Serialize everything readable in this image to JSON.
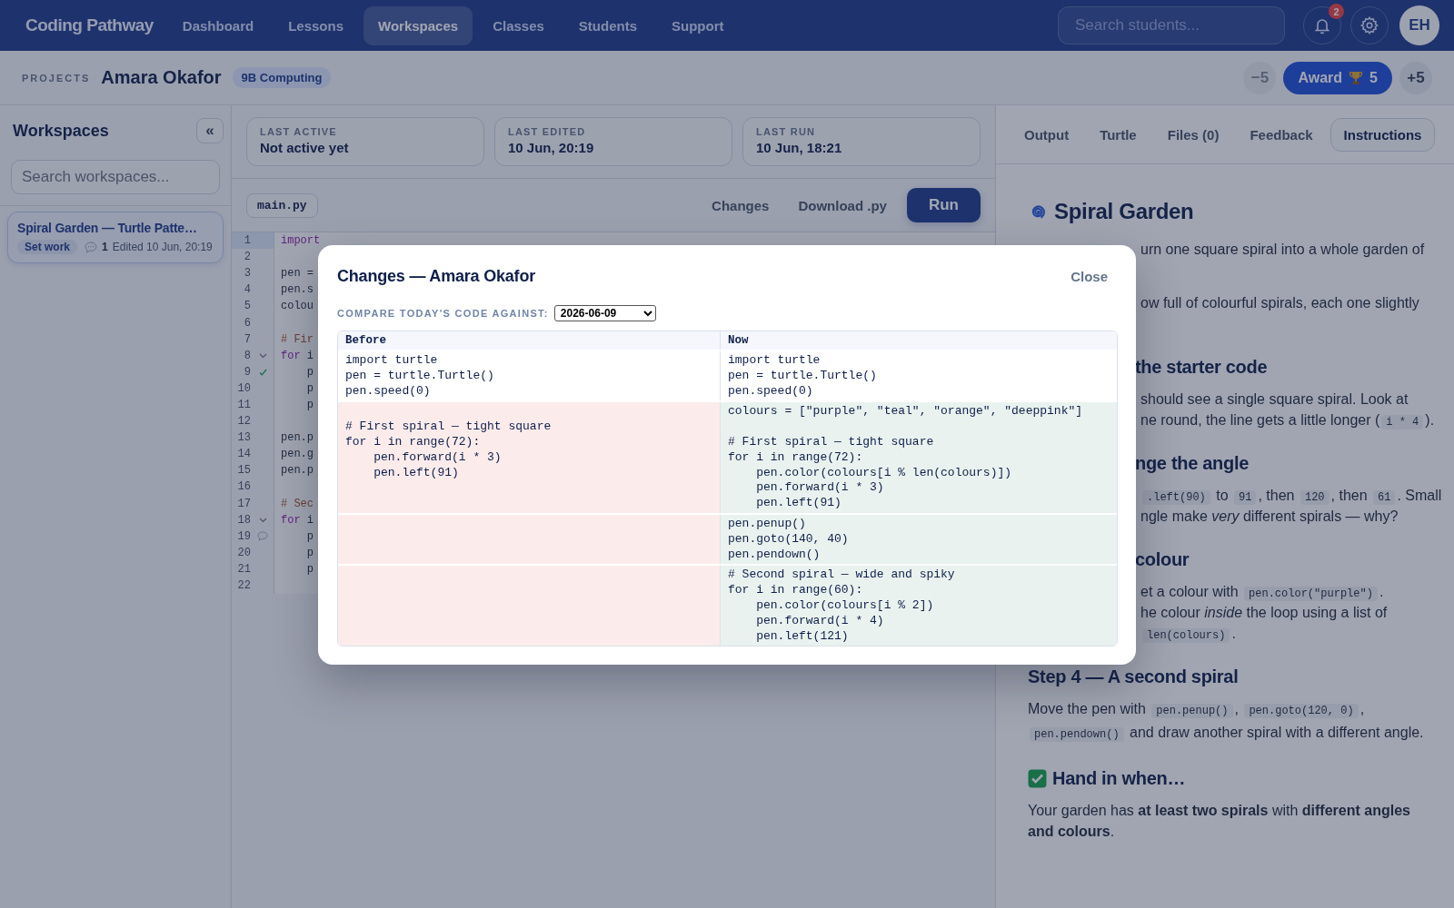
{
  "app": {
    "name": "Coding Pathway"
  },
  "nav": [
    {
      "label": "Dashboard",
      "selected": false
    },
    {
      "label": "Lessons",
      "selected": false
    },
    {
      "label": "Workspaces",
      "selected": true
    },
    {
      "label": "Classes",
      "selected": false
    },
    {
      "label": "Students",
      "selected": false
    },
    {
      "label": "Support",
      "selected": false
    }
  ],
  "search": {
    "placeholder": "Search students..."
  },
  "notifications": {
    "count": "2"
  },
  "user": {
    "initials": "EH"
  },
  "project_bar": {
    "section": "PROJECTS",
    "student": "Amara Okafor",
    "class_tag": "9B Computing",
    "points": [
      {
        "kind": "minus",
        "label": "−5",
        "disabled": true
      },
      {
        "kind": "award",
        "label": "Award",
        "count": "5",
        "disabled": false
      },
      {
        "kind": "plus",
        "label": "+5",
        "disabled": false
      }
    ]
  },
  "sidebar": {
    "title": "Workspaces",
    "collapse_label": "«",
    "search": {
      "placeholder": "Search workspaces..."
    },
    "items": [
      {
        "title": "Spiral Garden — Turtle Patte…",
        "tag": "Set work",
        "comments": "1",
        "edited": "Edited 10 Jun, 20:19",
        "selected": true
      }
    ]
  },
  "stats": [
    {
      "label": "LAST ACTIVE",
      "value": "Not active yet"
    },
    {
      "label": "LAST EDITED",
      "value": "10 Jun, 20:19"
    },
    {
      "label": "LAST RUN",
      "value": "10 Jun, 18:21"
    }
  ],
  "editor_toolbar": {
    "file": "main.py",
    "actions": [
      "Changes",
      "Download .py"
    ],
    "run": "Run"
  },
  "editor": {
    "lines": [
      {
        "number": "1",
        "active": true,
        "tokens": [
          {
            "kind": "keyword",
            "text": "import"
          }
        ]
      },
      {
        "number": "2",
        "active": false
      },
      {
        "number": "3",
        "active": false,
        "tokens": [
          {
            "kind": "plain",
            "text": "pen ="
          }
        ]
      },
      {
        "number": "4",
        "active": false,
        "tokens": [
          {
            "kind": "plain",
            "text": "pen.s"
          }
        ]
      },
      {
        "number": "5",
        "active": false,
        "tokens": [
          {
            "kind": "plain",
            "text": "colou"
          }
        ]
      },
      {
        "number": "6",
        "active": false
      },
      {
        "number": "7",
        "active": false,
        "tokens": [
          {
            "kind": "comment",
            "text": "# Fir"
          }
        ]
      },
      {
        "number": "8",
        "active": false,
        "kind": "fold",
        "tokens": [
          {
            "kind": "keyword",
            "text": "for"
          },
          {
            "kind": "plain",
            "text": " i"
          }
        ]
      },
      {
        "number": "9",
        "active": false,
        "kind": "check",
        "tokens": [
          {
            "kind": "plain",
            "text": "    p"
          }
        ]
      },
      {
        "number": "10",
        "active": false,
        "tokens": [
          {
            "kind": "plain",
            "text": "    p"
          }
        ]
      },
      {
        "number": "11",
        "active": false,
        "tokens": [
          {
            "kind": "plain",
            "text": "    p"
          }
        ]
      },
      {
        "number": "12",
        "active": false
      },
      {
        "number": "13",
        "active": false,
        "tokens": [
          {
            "kind": "plain",
            "text": "pen.p"
          }
        ]
      },
      {
        "number": "14",
        "active": false,
        "tokens": [
          {
            "kind": "plain",
            "text": "pen.g"
          }
        ]
      },
      {
        "number": "15",
        "active": false,
        "tokens": [
          {
            "kind": "plain",
            "text": "pen.p"
          }
        ]
      },
      {
        "number": "16",
        "active": false
      },
      {
        "number": "17",
        "active": false,
        "tokens": [
          {
            "kind": "comment",
            "text": "# Sec"
          }
        ]
      },
      {
        "number": "18",
        "active": false,
        "kind": "fold",
        "tokens": [
          {
            "kind": "keyword",
            "text": "for"
          },
          {
            "kind": "plain",
            "text": " i"
          }
        ]
      },
      {
        "number": "19",
        "active": false,
        "kind": "comment",
        "tokens": [
          {
            "kind": "plain",
            "text": "    p"
          }
        ]
      },
      {
        "number": "20",
        "active": false,
        "tokens": [
          {
            "kind": "plain",
            "text": "    p"
          }
        ]
      },
      {
        "number": "21",
        "active": false,
        "tokens": [
          {
            "kind": "plain",
            "text": "    p"
          }
        ]
      },
      {
        "number": "22",
        "active": false
      }
    ]
  },
  "panel_tabs": [
    {
      "label": "Output",
      "selected": false
    },
    {
      "label": "Turtle",
      "selected": false
    },
    {
      "label": "Files (0)",
      "selected": false
    },
    {
      "label": "Feedback",
      "selected": false
    },
    {
      "label": "Instructions",
      "selected": true
    }
  ],
  "instructions": [
    {
      "kind": "title",
      "text": "Spiral Garden"
    },
    {
      "kind": "cut-para",
      "lines": [
        [
          {
            "kind": "text",
            "text": "urn one square spiral into a whole garden of"
          }
        ]
      ]
    },
    {
      "kind": "cut-para",
      "lines": [
        [
          {
            "kind": "text",
            "text": "ow full of colourful spirals, each one slightly"
          }
        ]
      ]
    },
    {
      "kind": "cut-heading",
      "text": "the starter code"
    },
    {
      "kind": "cut-para",
      "lines": [
        [
          {
            "kind": "text",
            "text": "should see a single square spiral. Look at"
          }
        ],
        [
          {
            "kind": "text",
            "text": "ne round, the line gets a little longer ("
          },
          {
            "kind": "code",
            "text": "i * 4"
          },
          {
            "kind": "text",
            "text": ")."
          }
        ]
      ]
    },
    {
      "kind": "cut-heading",
      "text": "nge the angle"
    },
    {
      "kind": "cut-para",
      "lines": [
        [
          {
            "kind": "code",
            "text": ".left(90)"
          },
          {
            "kind": "text",
            "text": " to "
          },
          {
            "kind": "code",
            "text": "91"
          },
          {
            "kind": "text",
            "text": ", then "
          },
          {
            "kind": "code",
            "text": "120"
          },
          {
            "kind": "text",
            "text": ", then "
          },
          {
            "kind": "code",
            "text": "61"
          },
          {
            "kind": "text",
            "text": ". Small"
          }
        ],
        [
          {
            "kind": "text",
            "text": "ngle make *very* different spirals — why?"
          }
        ]
      ]
    },
    {
      "kind": "cut-heading",
      "text": "colour"
    },
    {
      "kind": "cut-para",
      "lines": [
        [
          {
            "kind": "text",
            "text": "et a colour with "
          },
          {
            "kind": "code",
            "text": "pen.color(\"purple\")"
          },
          {
            "kind": "text",
            "text": "."
          }
        ],
        [
          {
            "kind": "text",
            "text": "he colour *inside* the loop using a list of"
          }
        ],
        [
          {
            "kind": "code",
            "text": "len(colours)"
          },
          {
            "kind": "text",
            "text": "."
          }
        ]
      ]
    },
    {
      "kind": "heading",
      "text": "Step 4 — A second spiral"
    },
    {
      "kind": "para",
      "segments": [
        {
          "kind": "text",
          "text": "Move the pen with "
        },
        {
          "kind": "code",
          "text": "pen.penup()"
        },
        {
          "kind": "text",
          "text": ", "
        },
        {
          "kind": "code",
          "text": "pen.goto(120, 0)"
        },
        {
          "kind": "text",
          "text": ", "
        },
        {
          "kind": "code",
          "text": "pen.pendown()"
        },
        {
          "kind": "text",
          "text": " and draw another spiral with a different angle."
        }
      ]
    },
    {
      "kind": "check-heading",
      "text": "Hand in when…"
    },
    {
      "kind": "para",
      "segments": [
        {
          "kind": "text",
          "text": "Your garden has **at least two spirals** with **different angles and colours**."
        }
      ]
    }
  ],
  "modal": {
    "title": "Changes — Amara Okafor",
    "close": "Close",
    "compare_label": "COMPARE TODAY'S CODE AGAINST:",
    "compare_value": "2026-06-09",
    "columns": [
      "Before",
      "Now"
    ],
    "hunks": [
      {
        "kind": "same",
        "before": "import turtle\npen = turtle.Turtle()\npen.speed(0)",
        "now": "import turtle\npen = turtle.Turtle()\npen.speed(0)"
      },
      {
        "kind": "changed",
        "before": "\n# First spiral — tight square\nfor i in range(72):\n    pen.forward(i * 3)\n    pen.left(91)",
        "now": "colours = [\"purple\", \"teal\", \"orange\", \"deeppink\"]\n\n# First spiral — tight square\nfor i in range(72):\n    pen.color(colours[i % len(colours)])\n    pen.forward(i * 3)\n    pen.left(91)"
      },
      {
        "kind": "changed",
        "now": "pen.penup()\npen.goto(140, 40)\npen.pendown()"
      },
      {
        "kind": "changed",
        "now": "# Second spiral — wide and spiky\nfor i in range(60):\n    pen.color(colours[i % 2])\n    pen.forward(i * 4)\n    pen.left(121)"
      }
    ]
  }
}
